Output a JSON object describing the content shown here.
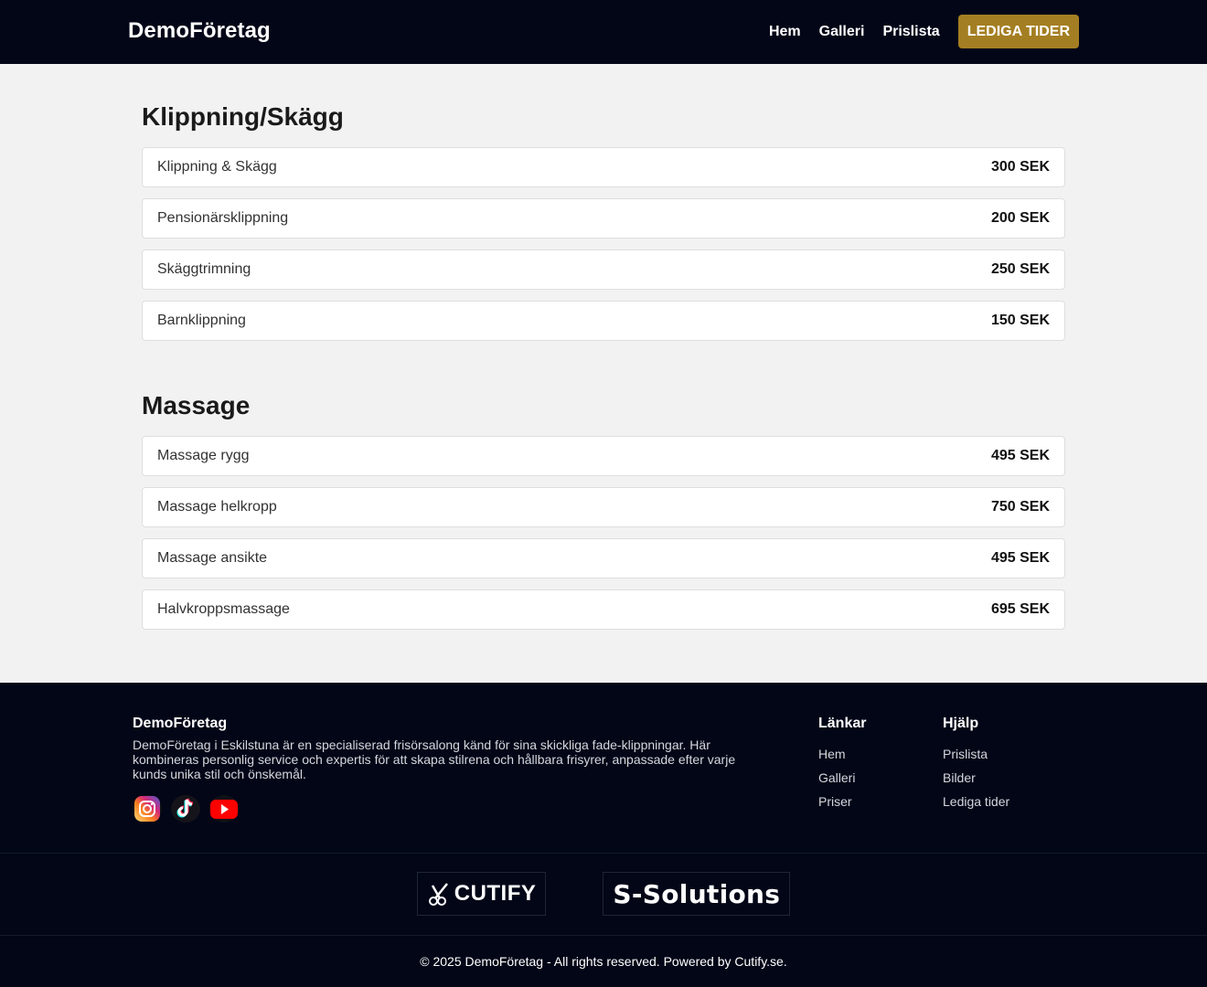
{
  "header": {
    "brand": "DemoFöretag",
    "nav": [
      "Hem",
      "Galleri",
      "Prislista"
    ],
    "cta": "LEDIGA TIDER"
  },
  "sections": [
    {
      "title": "Klippning/Skägg",
      "items": [
        {
          "name": "Klippning & Skägg",
          "price": "300 SEK"
        },
        {
          "name": "Pensionärsklippning",
          "price": "200 SEK"
        },
        {
          "name": "Skäggtrimning",
          "price": "250 SEK"
        },
        {
          "name": "Barnklippning",
          "price": "150 SEK"
        }
      ]
    },
    {
      "title": "Massage",
      "items": [
        {
          "name": "Massage rygg",
          "price": "495 SEK"
        },
        {
          "name": "Massage helkropp",
          "price": "750 SEK"
        },
        {
          "name": "Massage ansikte",
          "price": "495 SEK"
        },
        {
          "name": "Halvkroppsmassage",
          "price": "695 SEK"
        }
      ]
    }
  ],
  "footer": {
    "title": "DemoFöretag",
    "description": "DemoFöretag i Eskilstuna är en specialiserad frisörsalong känd för sina skickliga fade-klippningar. Här kombineras personlig service och expertis för att skapa stilrena och hållbara frisyrer, anpassade efter varje kunds unika stil och önskemål.",
    "socials": [
      "instagram-icon",
      "tiktok-icon",
      "youtube-icon"
    ],
    "links": {
      "title": "Länkar",
      "items": [
        "Hem",
        "Galleri",
        "Priser"
      ]
    },
    "help": {
      "title": "Hjälp",
      "items": [
        "Prislista",
        "Bilder",
        "Lediga tider"
      ]
    },
    "partners": [
      "CUTIFY",
      "S-Solutions"
    ],
    "copyright": "© 2025 DemoFöretag - All rights reserved. Powered by Cutify.se."
  },
  "colors": {
    "header_bg": "#020617",
    "accent": "#a47e22",
    "page_bg": "#f2f2f2"
  }
}
